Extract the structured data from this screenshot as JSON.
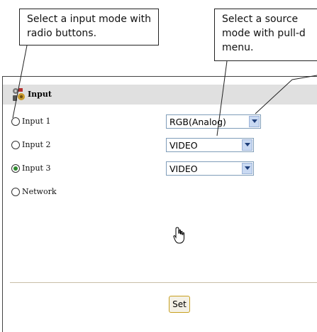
{
  "callouts": {
    "radio_hint": "Select a input mode with radio buttons.",
    "select_hint_line1": "Select a source",
    "select_hint_line2": "mode with pull-d",
    "select_hint_line3": "menu."
  },
  "panel": {
    "title": "Input",
    "title_icon": "input-icon",
    "rows": [
      {
        "label": "Input 1",
        "checked": false,
        "select_value": "RGB(Analog)"
      },
      {
        "label": "Input 2",
        "checked": false,
        "select_value": "VIDEO"
      },
      {
        "label": "Input 3",
        "checked": true,
        "select_value": "VIDEO"
      },
      {
        "label": "Network",
        "checked": false
      }
    ],
    "set_button": "Set"
  },
  "colors": {
    "header_bg": "#e0e0e0",
    "radio_checked": "#2f8a2f",
    "select_border": "#7f9db9",
    "set_button_border": "#c8a020"
  }
}
